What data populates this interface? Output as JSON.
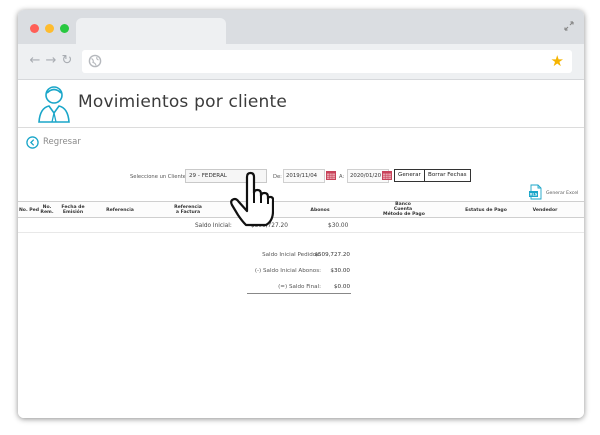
{
  "browser": {
    "colors": {
      "close": "#ff5f57",
      "minimize": "#febc2e",
      "maximize": "#28c840",
      "star": "#f5b400"
    },
    "nav": {
      "back": "←",
      "forward": "→",
      "reload": "↻"
    },
    "icons": [
      "globe-icon",
      "star-icon",
      "expand-icon"
    ]
  },
  "header": {
    "title": "Movimientos por cliente",
    "icons": [
      "user-avatar-icon"
    ]
  },
  "back": {
    "label": "Regresar"
  },
  "filters": {
    "client_label": "Seleccione un Cliente:",
    "client_value": "29 - FEDERAL",
    "de_label": "De:",
    "date_from": "2019/11/04",
    "a_label": "A:",
    "date_to": "2020/01/20",
    "generate_label": "Generar",
    "clear_label": "Borrar Fechas",
    "excel_label": "Generar Excel",
    "excel_icon_text": "XLS"
  },
  "table": {
    "headers": [
      [
        "No. Ped"
      ],
      [
        "No.",
        "Rem."
      ],
      [
        "Fecha de",
        "Emisión"
      ],
      [
        "Referencia"
      ],
      [
        "Referencia",
        "a Factura"
      ],
      [
        "Abonos"
      ],
      [
        "Banco",
        "Cuenta",
        "Método de Pago"
      ],
      [
        "Estatus de Pago"
      ],
      [
        "Vendedor"
      ]
    ],
    "saldo_row": {
      "label": "Saldo Inicial:",
      "amount": "$509,727.20",
      "abono": "$30.00"
    }
  },
  "summary": {
    "rows": [
      {
        "label": "Saldo Inicial Pedidos:",
        "value": "$509,727.20"
      },
      {
        "label": "(-) Saldo Inicial Abonos:",
        "value": "$30.00"
      },
      {
        "label": "(=) Saldo Final:",
        "value": "$0.00"
      }
    ]
  },
  "colors": {
    "accent": "#1aa6c9",
    "calendar": "#c8435a"
  }
}
